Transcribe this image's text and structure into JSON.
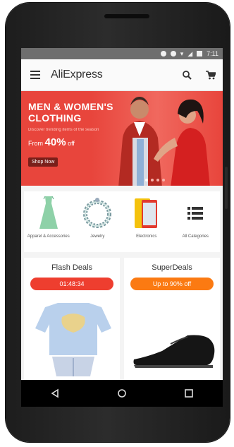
{
  "status_bar": {
    "time": "7:11"
  },
  "app_bar": {
    "title": "AliExpress",
    "menu_icon": "hamburger-menu-icon",
    "search_icon": "search-icon",
    "cart_icon": "cart-icon"
  },
  "banner": {
    "headline_line1": "MEN & WOMEN'S",
    "headline_line2": "CLOTHING",
    "subline": "Discover trending items of the season",
    "from_label": "From",
    "discount": "40%",
    "off_label": "off",
    "shop_button": "Shop Now",
    "colors": {
      "background": "#e8453c"
    }
  },
  "categories": [
    {
      "label": "Apparel & Accessories",
      "icon": "dress-icon"
    },
    {
      "label": "Jewelry",
      "icon": "necklace-icon"
    },
    {
      "label": "Electronics",
      "icon": "phone-icon"
    },
    {
      "label": "All Categories",
      "icon": "list-icon"
    }
  ],
  "deals": {
    "flash": {
      "title": "Flash Deals",
      "badge": "01:48:34",
      "color": "#ee3e2f"
    },
    "super": {
      "title": "SuperDeals",
      "badge": "Up to 90% off",
      "color": "#fb7a12"
    }
  },
  "nav": {
    "back_icon": "back-icon",
    "home_icon": "home-icon",
    "recents_icon": "recents-icon"
  }
}
